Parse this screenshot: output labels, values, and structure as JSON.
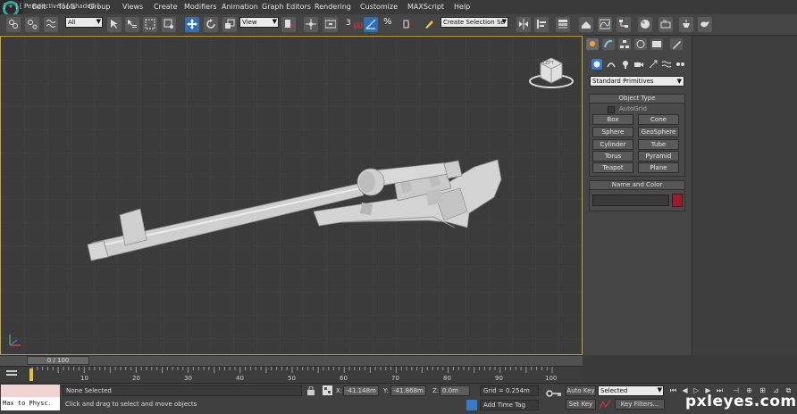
{
  "menu": [
    "Edit",
    "Tools",
    "Group",
    "Views",
    "Create",
    "Modifiers",
    "Animation",
    "Graph Editors",
    "Rendering",
    "Customize",
    "MAXScript",
    "Help"
  ],
  "toolbar": {
    "selection_filter": "All",
    "ref_coord": "View",
    "snap_label": "3",
    "named_selection": "Create Selection Se"
  },
  "viewport": {
    "label": "[ + ] [ Perspective ] [ Shaded ]",
    "viewcube_text": "LEFT",
    "colors": {
      "border": "#c7a23a",
      "background": "#3b3b3b",
      "model": "#d8d8d8"
    }
  },
  "command_panel": {
    "category": "Standard Primitives",
    "object_type_title": "Object Type",
    "autogrid_label": "AutoGrid",
    "buttons": [
      "Box",
      "Cone",
      "Sphere",
      "GeoSphere",
      "Cylinder",
      "Tube",
      "Torus",
      "Pyramid",
      "Teapot",
      "Plane"
    ],
    "name_color_title": "Name and Color",
    "object_color": "#9c1b2c"
  },
  "timeline": {
    "frame_display": "0 / 100",
    "ticks": [
      "10",
      "20",
      "30",
      "40",
      "50",
      "60",
      "70",
      "80",
      "90",
      "100"
    ]
  },
  "status": {
    "maxscript_listener": "Max to Physc.",
    "selection": "None Selected",
    "prompt": "Click and drag to select and move objects",
    "x_label": "X:",
    "x_value": "-41.148m",
    "y_label": "Y:",
    "y_value": "-41.868m",
    "z_label": "Z:",
    "z_value": "0.0m",
    "grid": "Grid = 0.254m",
    "add_time_tag": "Add Time Tag",
    "auto_key": "Auto Key",
    "set_key": "Set Key",
    "key_mode": "Selected",
    "key_filters": "Key Filters..."
  },
  "watermark": "pxleyes.com"
}
